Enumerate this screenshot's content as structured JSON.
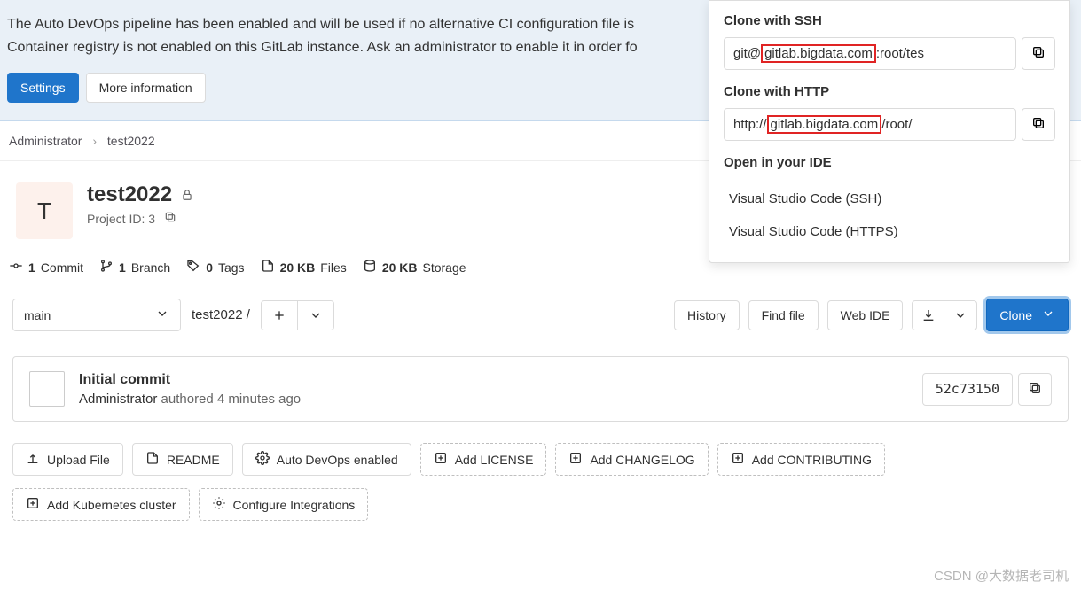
{
  "alert": {
    "line1": "The Auto DevOps pipeline has been enabled and will be used if no alternative CI configuration file is",
    "line2": "Container registry is not enabled on this GitLab instance. Ask an administrator to enable it in order fo",
    "settings_btn": "Settings",
    "more_info_btn": "More information"
  },
  "breadcrumbs": {
    "admin": "Administrator",
    "project": "test2022"
  },
  "project": {
    "initial": "T",
    "name": "test2022",
    "id_label": "Project ID: 3"
  },
  "stats": {
    "commits_n": "1",
    "commits_l": "Commit",
    "branches_n": "1",
    "branches_l": "Branch",
    "tags_n": "0",
    "tags_l": "Tags",
    "files_n": "20 KB",
    "files_l": "Files",
    "storage_n": "20 KB",
    "storage_l": "Storage"
  },
  "repo": {
    "branch": "main",
    "path": "test2022",
    "history": "History",
    "find_file": "Find file",
    "web_ide": "Web IDE",
    "clone": "Clone"
  },
  "commit": {
    "title": "Initial commit",
    "author": "Administrator",
    "authored": " authored ",
    "time": "4 minutes ago",
    "sha": "52c73150"
  },
  "quick_actions": {
    "upload": "Upload File",
    "readme": "README",
    "auto_devops": "Auto DevOps enabled",
    "license": "Add LICENSE",
    "changelog": "Add CHANGELOG",
    "contributing": "Add CONTRIBUTING",
    "kubernetes": "Add Kubernetes cluster",
    "integrations": "Configure Integrations"
  },
  "clone_menu": {
    "ssh_title": "Clone with SSH",
    "ssh_prefix": "git@",
    "ssh_domain": "gitlab.bigdata.com",
    "ssh_suffix": ":root/tes",
    "http_title": "Clone with HTTP",
    "http_prefix": "http://",
    "http_domain": "gitlab.bigdata.com",
    "http_suffix": "/root/",
    "ide_title": "Open in your IDE",
    "ide_ssh": "Visual Studio Code (SSH)",
    "ide_https": "Visual Studio Code (HTTPS)"
  },
  "watermark": "CSDN @大数据老司机"
}
